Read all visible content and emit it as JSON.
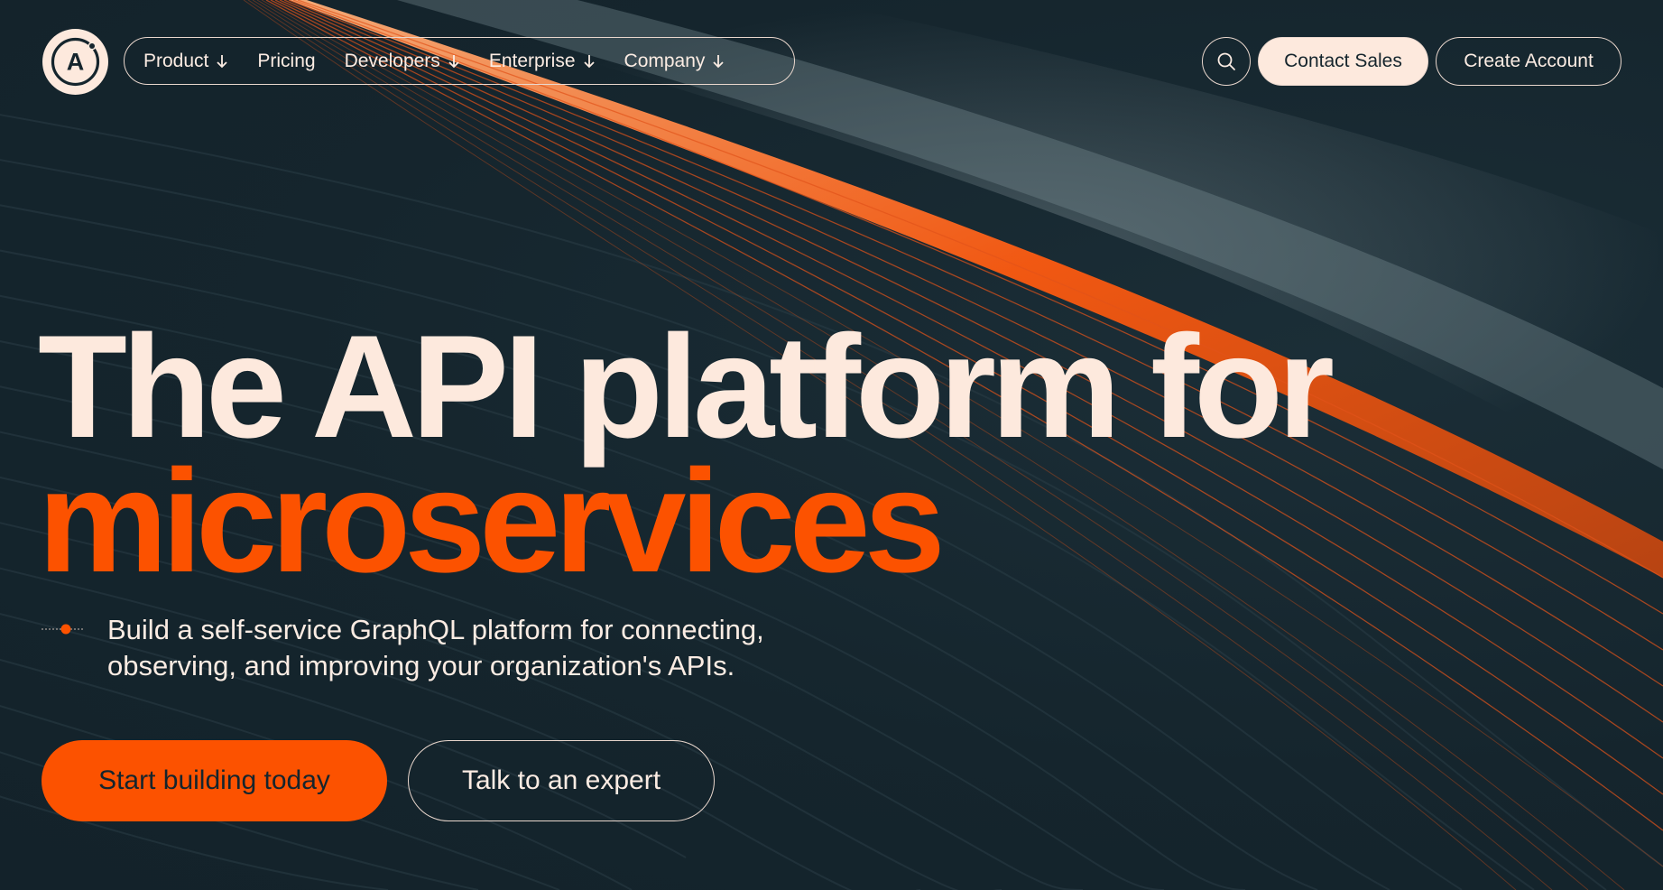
{
  "nav": {
    "logo_letter": "A",
    "items": [
      {
        "label": "Product",
        "has_dropdown": true,
        "icon": "arrow-down-icon"
      },
      {
        "label": "Pricing",
        "has_dropdown": false
      },
      {
        "label": "Developers",
        "has_dropdown": true,
        "icon": "arrow-down-icon"
      },
      {
        "label": "Enterprise",
        "has_dropdown": true,
        "icon": "arrow-down-icon"
      },
      {
        "label": "Company",
        "has_dropdown": true,
        "icon": "arrow-down-icon"
      }
    ],
    "search_icon": "search-icon",
    "contact_label": "Contact Sales",
    "create_label": "Create Account"
  },
  "hero": {
    "headline_line1": "The API platform for",
    "headline_line2": "microservices",
    "subtitle_line1": "Build a self-service GraphQL platform for connecting,",
    "subtitle_line2": "observing, and improving your organization's APIs.",
    "cta_primary": "Start building today",
    "cta_secondary": "Talk to an expert"
  },
  "colors": {
    "background": "#15252d",
    "cream": "#fde9dd",
    "accent": "#fc5200"
  }
}
